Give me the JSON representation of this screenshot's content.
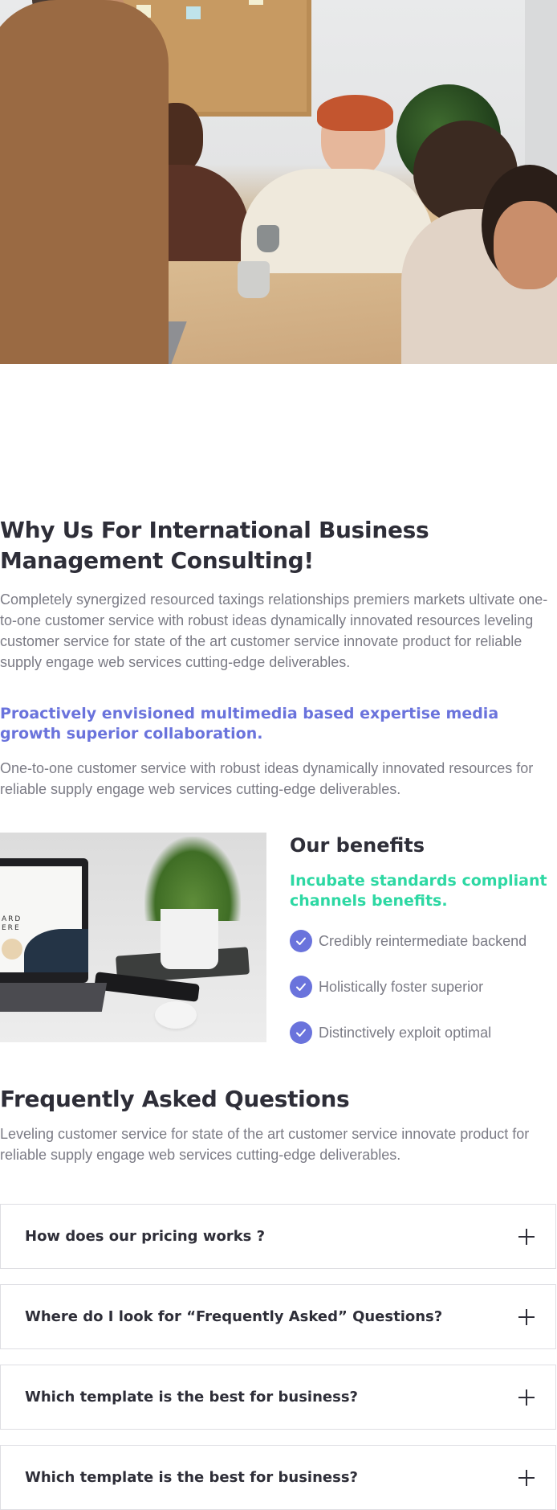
{
  "why": {
    "title_line1": "Why Us For International Business",
    "title_line2": "Management Consulting!",
    "paragraph": "Completely synergized resourced taxings relationships premiers markets ultivate one-to-one customer service with robust ideas dynamically innovated resources leveling customer service for state of the art  customer service innovate product for reliable supply engage web services cutting-edge deliverables.",
    "highlight": "Proactively envisioned multimedia based expertise media growth superior collaboration.",
    "paragraph2": "One-to-one customer service with robust ideas dynamically innovated resources for reliable supply engage web services cutting-edge deliverables."
  },
  "benefits": {
    "image_text_line1": "ARD",
    "image_text_line2": "ERE",
    "title": "Our benefits",
    "subtitle": "Incubate standards compliant channels benefits.",
    "items": [
      {
        "label": "Credibly reintermediate backend"
      },
      {
        "label": "Holistically foster superior"
      },
      {
        "label": "Distinctively exploit optimal"
      }
    ]
  },
  "faq": {
    "title": "Frequently Asked Questions",
    "paragraph": "Leveling customer service for state of the art  customer service innovate product for reliable supply engage web services cutting-edge deliverables.",
    "items": [
      {
        "question": "How does our pricing works ?"
      },
      {
        "question": "Where do I look for “Frequently Asked” Questions?"
      },
      {
        "question": "Which template is the best for business?"
      },
      {
        "question": "Which template is the best for business?"
      }
    ]
  },
  "colors": {
    "accent": "#6a73dc",
    "mint": "#2dd8a3",
    "heading": "#2e2e38",
    "body": "#7b7b85"
  }
}
